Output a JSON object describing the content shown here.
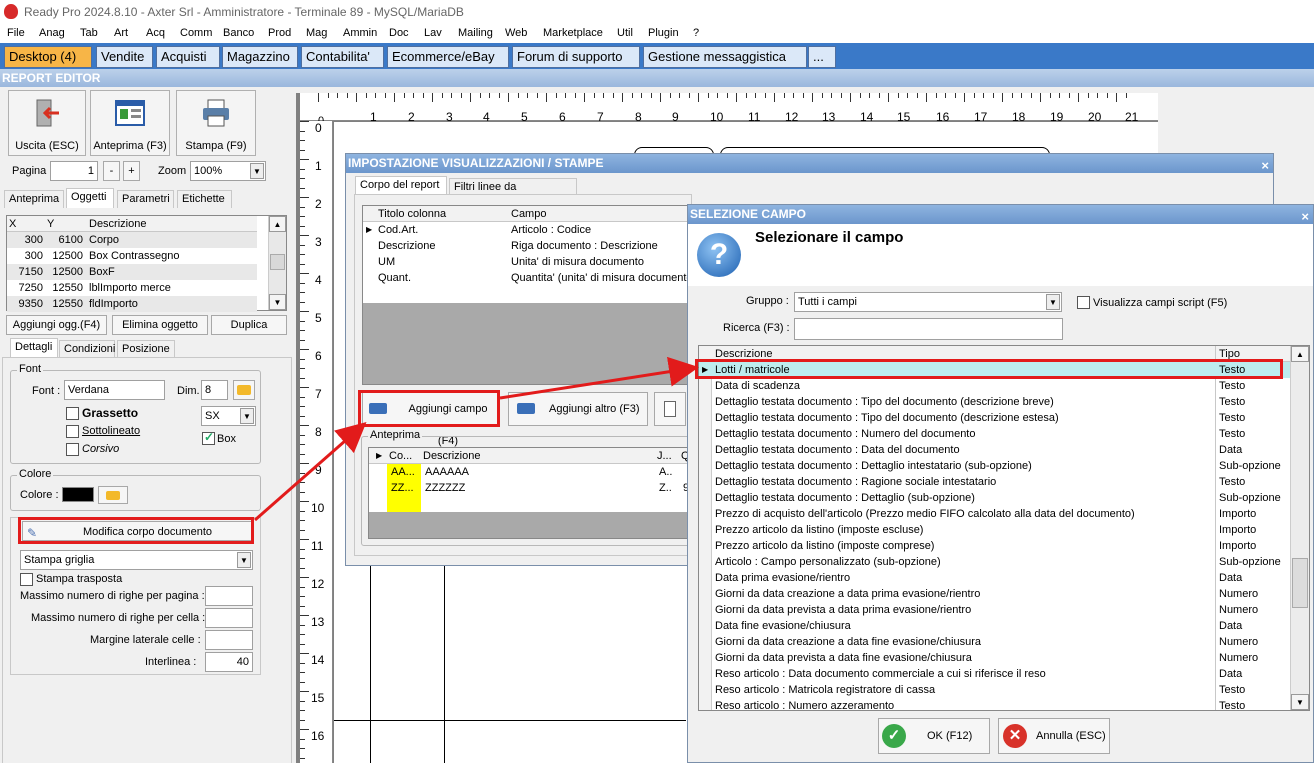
{
  "window": {
    "title": "Ready Pro 2024.8.10 - Axter Srl - Amministratore - Terminale 89 - MySQL/MariaDB"
  },
  "menu": [
    "File",
    "Anag",
    "Tab",
    "Art",
    "Acq",
    "Comm",
    "Banco",
    "Prod",
    "Mag",
    "Ammin",
    "Doc",
    "Lav",
    "Mailing",
    "Web",
    "Marketplace",
    "Util",
    "Plugin",
    "?"
  ],
  "app_tabs": [
    "Desktop (4)",
    "Vendite",
    "Acquisti",
    "Magazzino",
    "Contabilita'",
    "Ecommerce/eBay",
    "Forum di supporto",
    "Gestione messaggistica",
    "..."
  ],
  "section": "REPORT EDITOR",
  "toolbar": {
    "exit": "Uscita (ESC)",
    "preview": "Anteprima (F3)",
    "print": "Stampa (F9)"
  },
  "pager": {
    "page_label": "Pagina",
    "page_value": "1",
    "minus": "-",
    "plus": "+",
    "zoom_label": "Zoom",
    "zoom_value": "100%"
  },
  "left_tabs": [
    "Anteprima",
    "Oggetti",
    "Parametri",
    "Etichette"
  ],
  "objects": {
    "headers": [
      "X",
      "Y",
      "Descrizione"
    ],
    "rows": [
      [
        "300",
        "6100",
        "Corpo"
      ],
      [
        "300",
        "12500",
        "Box Contrassegno"
      ],
      [
        "7150",
        "12500",
        "BoxF"
      ],
      [
        "7250",
        "12550",
        "lblImporto merce"
      ],
      [
        "9350",
        "12550",
        "fldImporto"
      ]
    ]
  },
  "obj_buttons": {
    "add": "Aggiungi ogg.(F4)",
    "delete": "Elimina oggetto",
    "duplicate": "Duplica"
  },
  "detail_tabs": [
    "Dettagli",
    "Condizioni",
    "Posizione"
  ],
  "font": {
    "group": "Font",
    "font_label": "Font :",
    "font_value": "Verdana",
    "dim_label": "Dim.",
    "dim_value": "8",
    "bold": "Grassetto",
    "underline": "Sottolineato",
    "italic": "Corsivo",
    "align": "SX",
    "box": "Box"
  },
  "color": {
    "group": "Colore",
    "label": "Colore :"
  },
  "body": {
    "edit_btn": "Modifica corpo documento",
    "grid_option": "Stampa griglia",
    "transpose": "Stampa trasposta",
    "max_rows_page": "Massimo numero di righe per pagina :",
    "max_rows_cell": "Massimo numero di righe per cella :",
    "side_margin": "Margine laterale celle :",
    "line_spacing": "Interlinea :",
    "line_spacing_value": "40"
  },
  "ruler_h": [
    "0",
    "1",
    "2",
    "3",
    "4",
    "5",
    "6",
    "7",
    "8",
    "9",
    "10",
    "11",
    "12",
    "13",
    "14",
    "15",
    "16",
    "17",
    "18",
    "19",
    "20",
    "21"
  ],
  "ruler_v": [
    "0",
    "1",
    "2",
    "3",
    "4",
    "5",
    "6",
    "7",
    "8",
    "9",
    "10",
    "11",
    "12",
    "13",
    "14",
    "15",
    "16"
  ],
  "dialog1": {
    "title": "IMPOSTAZIONE VISUALIZZAZIONI / STAMPE",
    "tabs": [
      "Corpo del report",
      "Filtri linee da visualizzare"
    ],
    "headers": [
      "Titolo colonna",
      "Campo"
    ],
    "rows": [
      [
        "Cod.Art.",
        "Articolo : Codice"
      ],
      [
        "Descrizione",
        "Riga documento : Descrizione"
      ],
      [
        "UM",
        "Unita' di misura documento"
      ],
      [
        "Quant.",
        "Quantita' (unita' di misura documento"
      ]
    ],
    "add_field": "Aggiungi campo (F4)",
    "add_other": "Aggiungi altro (F3)",
    "preview_group": "Anteprima",
    "preview_headers": [
      "Co...",
      "Descrizione",
      "J...",
      "Q"
    ],
    "preview_rows": [
      [
        "AA...",
        "AAAAAA",
        "A..",
        ""
      ],
      [
        "ZZ...",
        "ZZZZZZ",
        "Z..",
        "9"
      ]
    ]
  },
  "dialog2": {
    "title": "SELEZIONE CAMPO",
    "heading": "Selezionare il campo",
    "group_label": "Gruppo :",
    "group_value": "Tutti i campi",
    "script_label": "Visualizza campi script (F5)",
    "search_label": "Ricerca (F3) :",
    "headers": [
      "Descrizione",
      "Tipo"
    ],
    "rows": [
      [
        "Lotti / matricole",
        "Testo"
      ],
      [
        "Data di scadenza",
        "Testo"
      ],
      [
        "Dettaglio testata documento : Tipo del documento (descrizione breve)",
        "Testo"
      ],
      [
        "Dettaglio testata documento : Tipo del documento (descrizione estesa)",
        "Testo"
      ],
      [
        "Dettaglio testata documento : Numero del documento",
        "Testo"
      ],
      [
        "Dettaglio testata documento : Data del documento",
        "Data"
      ],
      [
        "Dettaglio testata documento : Dettaglio intestatario (sub-opzione)",
        "Sub-opzione"
      ],
      [
        "Dettaglio testata documento : Ragione sociale intestatario",
        "Testo"
      ],
      [
        "Dettaglio testata documento : Dettaglio (sub-opzione)",
        "Sub-opzione"
      ],
      [
        "Prezzo di acquisto dell'articolo (Prezzo medio FIFO calcolato alla data del documento)",
        "Importo"
      ],
      [
        "Prezzo articolo da listino (imposte escluse)",
        "Importo"
      ],
      [
        "Prezzo articolo da listino (imposte comprese)",
        "Importo"
      ],
      [
        "Articolo : Campo personalizzato (sub-opzione)",
        "Sub-opzione"
      ],
      [
        "Data prima evasione/rientro",
        "Data"
      ],
      [
        "Giorni da data creazione a data prima evasione/rientro",
        "Numero"
      ],
      [
        "Giorni da data prevista a data prima evasione/rientro",
        "Numero"
      ],
      [
        "Data fine evasione/chiusura",
        "Data"
      ],
      [
        "Giorni da data creazione a data fine evasione/chiusura",
        "Numero"
      ],
      [
        "Giorni da data prevista a data fine evasione/chiusura",
        "Numero"
      ],
      [
        "Reso articolo : Data documento commerciale a cui si riferisce il reso",
        "Data"
      ],
      [
        "Reso articolo : Matricola registratore di cassa",
        "Testo"
      ],
      [
        "Reso articolo : Numero azzeramento",
        "Testo"
      ]
    ],
    "ok": "OK (F12)",
    "cancel": "Annulla (ESC)"
  }
}
